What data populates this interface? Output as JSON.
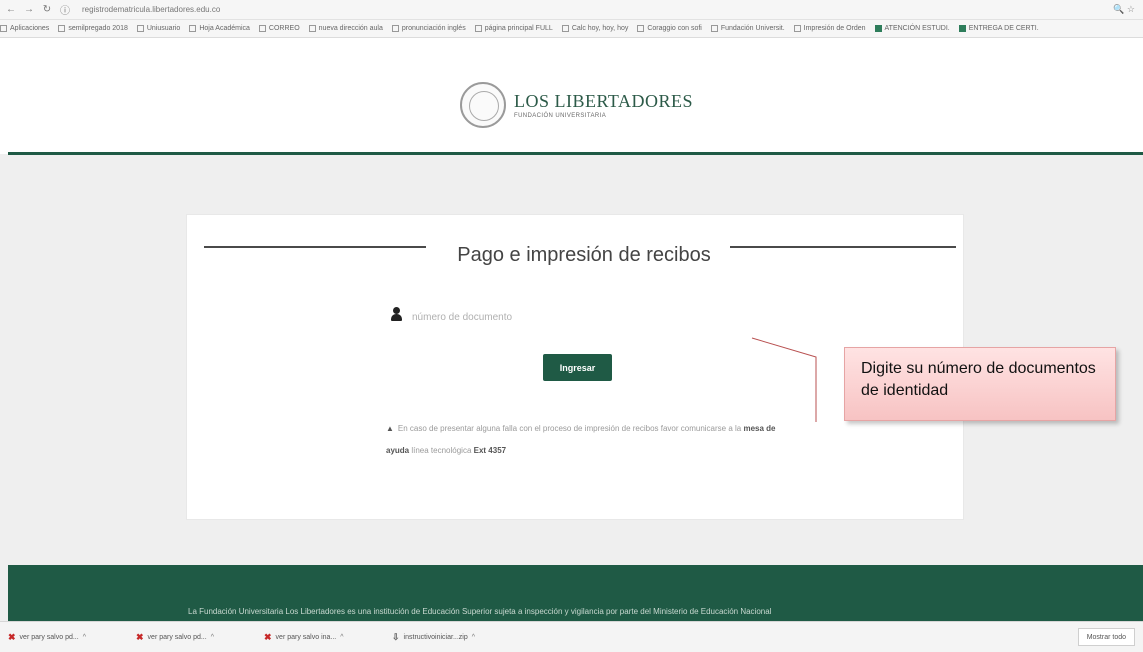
{
  "browser": {
    "url": "registrodematricula.libertadores.edu.co",
    "right_icons": "🔍 ☆",
    "bookmarks": [
      {
        "label": "Aplicaciones",
        "icon": "apps-icon"
      },
      {
        "label": "semilpregado 2018",
        "icon": "page-icon"
      },
      {
        "label": "Uniusuario",
        "icon": "page-icon"
      },
      {
        "label": "Hoja Académica",
        "icon": "page-icon"
      },
      {
        "label": "CORREO",
        "icon": "page-icon"
      },
      {
        "label": "nueva dirección aula",
        "icon": "page-icon"
      },
      {
        "label": "pronunciación inglés",
        "icon": "page-icon"
      },
      {
        "label": "página principal FULL",
        "icon": "page-icon"
      },
      {
        "label": "Calc hoy, hoy, hoy",
        "icon": "page-icon"
      },
      {
        "label": "Coraggio con sofi",
        "icon": "page-icon"
      },
      {
        "label": "Fundación Universit.",
        "icon": "page-icon"
      },
      {
        "label": "Impresión de Orden",
        "icon": "page-icon"
      },
      {
        "label": "ATENCIÓN ESTUDI.",
        "icon": "green-doc-icon"
      },
      {
        "label": "ENTREGA DE CERTI.",
        "icon": "green-doc-icon"
      }
    ]
  },
  "header": {
    "logo_title": "LOS LIBERTADORES",
    "logo_subtitle": "FUNDACIÓN UNIVERSITARIA"
  },
  "card": {
    "title": "Pago e impresión de recibos",
    "input_placeholder": "número de documento",
    "submit_label": "Ingresar",
    "help_prefix": "▲",
    "help_text_1": "En caso de presentar alguna falla con el proceso de impresión de recibos favor comunicarse a la",
    "help_link": "mesa de ayuda",
    "help_text_2": "línea tecnológica ",
    "help_ext": "Ext 4357"
  },
  "annotation": {
    "text": "Digite su número de documentos de identidad"
  },
  "footer": {
    "text": "La Fundación Universitaria Los Libertadores es una institución de Educación Superior sujeta a inspección y vigilancia por parte del Ministerio de Educación Nacional"
  },
  "downloads": {
    "items": [
      {
        "label": "ver pary salvo pd...",
        "icon": "pdf-icon"
      },
      {
        "label": "ver pary salvo pd...",
        "icon": "pdf-icon"
      },
      {
        "label": "ver pary salvo ina...",
        "icon": "pdf-icon"
      },
      {
        "label": "instructivoiniciar...zip",
        "icon": "file-icon"
      }
    ],
    "show_all_label": "Mostrar todo"
  },
  "colors": {
    "brand_green": "#1f5a45",
    "callout_fill": "#f7c3c3"
  }
}
